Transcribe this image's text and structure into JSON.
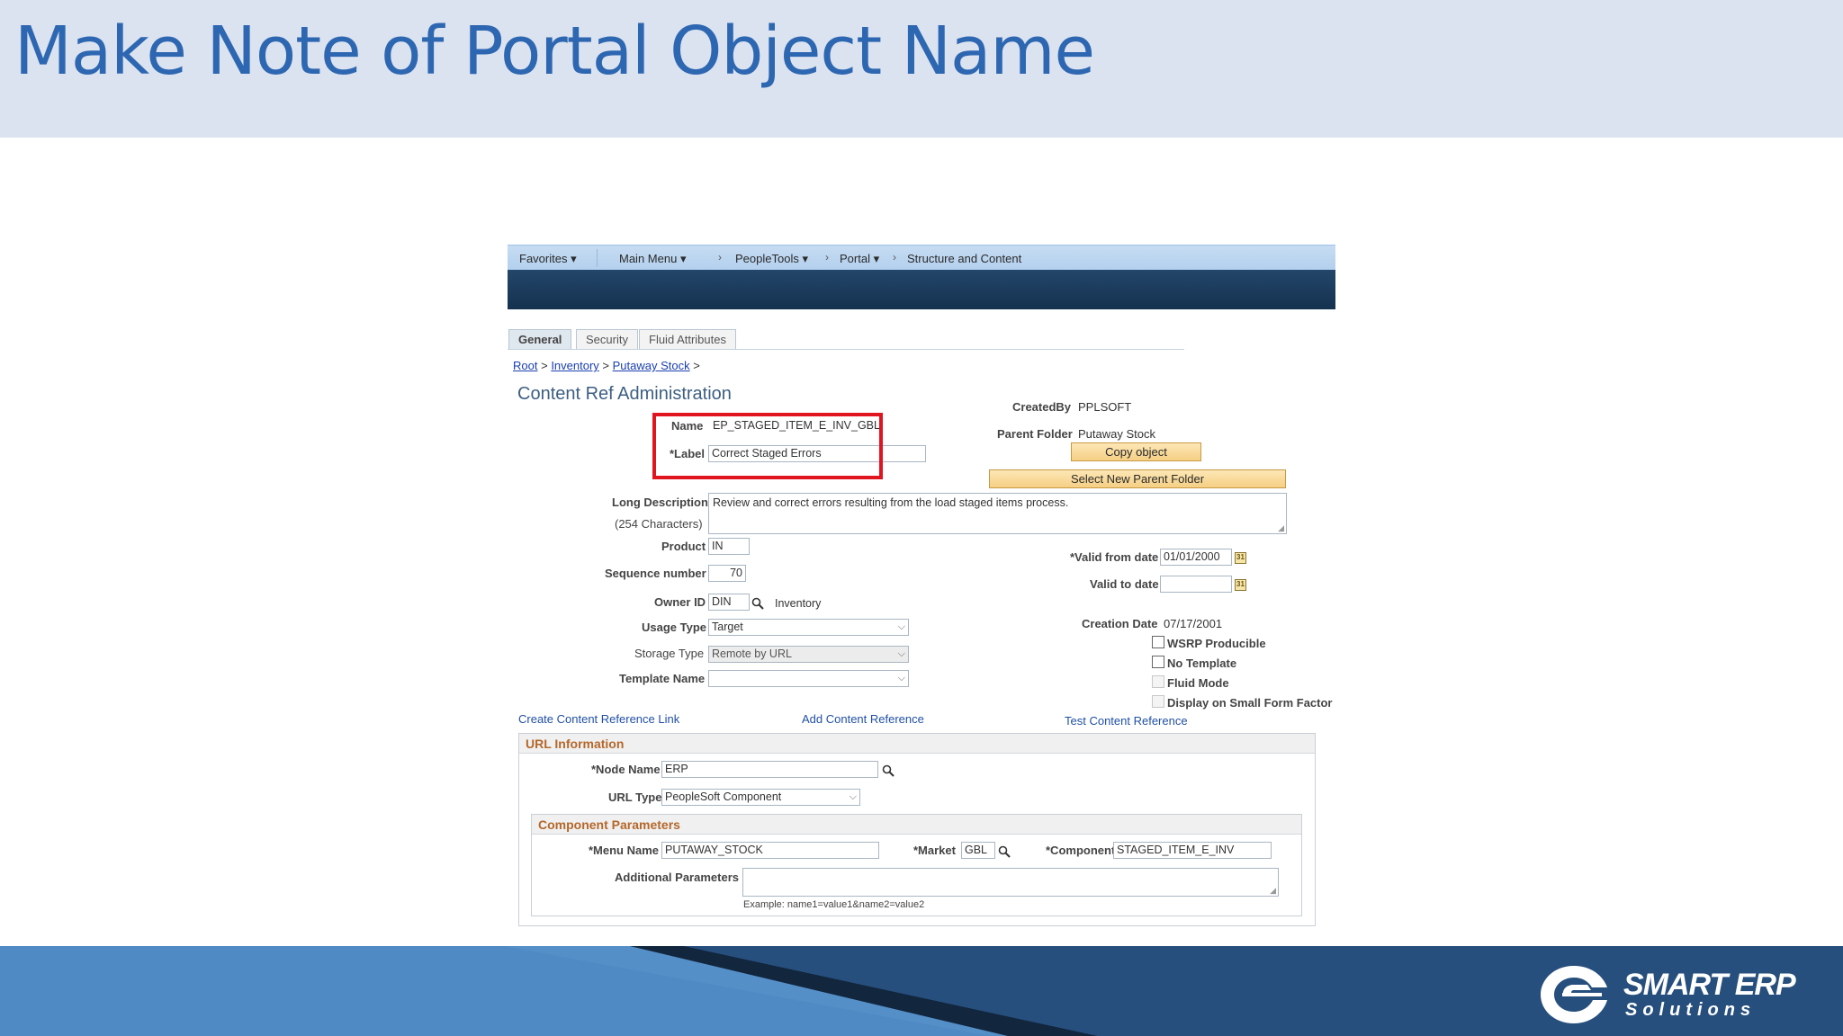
{
  "slide": {
    "title": "Make Note of Portal Object Name",
    "logo_line1": "SMART ERP",
    "logo_line2": "Solutions"
  },
  "nav": {
    "favorites": "Favorites",
    "main_menu": "Main Menu",
    "peopletools": "PeopleTools",
    "portal": "Portal",
    "structure": "Structure and Content"
  },
  "tabs": {
    "general": "General",
    "security": "Security",
    "fluid": "Fluid Attributes"
  },
  "breadcrumb": {
    "root": "Root",
    "inventory": "Inventory",
    "putaway": "Putaway Stock",
    "sep": ">"
  },
  "heading": "Content Ref Administration",
  "form": {
    "name_label": "Name",
    "name_value": "EP_STAGED_ITEM_E_INV_GBL",
    "label_label": "*Label",
    "label_value": "Correct Staged Errors",
    "createdby_label": "CreatedBy",
    "createdby_value": "PPLSOFT",
    "parent_folder_label": "Parent Folder",
    "parent_folder_value": "Putaway Stock",
    "copy_object": "Copy object",
    "select_parent": "Select New Parent Folder",
    "long_desc_label": "Long Description",
    "long_desc_sub": "(254 Characters)",
    "long_desc_value": "Review and correct errors resulting from the load staged items process.",
    "product_label": "Product",
    "product_value": "IN",
    "seq_label": "Sequence number",
    "seq_value": "70",
    "owner_label": "Owner ID",
    "owner_value": "DIN",
    "owner_desc": "Inventory",
    "usage_label": "Usage Type",
    "usage_value": "Target",
    "storage_label": "Storage Type",
    "storage_value": "Remote by URL",
    "template_label": "Template Name",
    "template_value": "",
    "valid_from_label": "*Valid from date",
    "valid_from_value": "01/01/2000",
    "valid_to_label": "Valid to date",
    "valid_to_value": "",
    "creation_label": "Creation Date",
    "creation_value": "07/17/2001",
    "wsrp": "WSRP Producible",
    "no_template": "No Template",
    "fluid_mode": "Fluid Mode",
    "small_form": "Display on Small Form Factor"
  },
  "links": {
    "create": "Create Content Reference Link",
    "add": "Add Content Reference",
    "test": "Test Content Reference"
  },
  "url_info": {
    "title": "URL Information",
    "node_label": "*Node Name",
    "node_value": "ERP",
    "url_type_label": "URL Type",
    "url_type_value": "PeopleSoft Component"
  },
  "component": {
    "title": "Component Parameters",
    "menu_label": "*Menu Name",
    "menu_value": "PUTAWAY_STOCK",
    "market_label": "*Market",
    "market_value": "GBL",
    "component_label": "*Component",
    "component_value": "STAGED_ITEM_E_INV",
    "additional_label": "Additional Parameters",
    "additional_value": "",
    "example": "Example: name1=value1&name2=value2"
  }
}
